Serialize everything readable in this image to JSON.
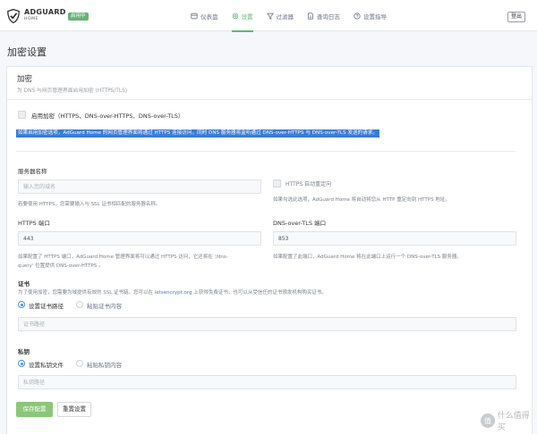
{
  "header": {
    "logo_name": "ADGUARD",
    "logo_sub": "HOME",
    "status_badge": "启用中",
    "nav": [
      {
        "label": "仪表盘",
        "icon": "dashboard-icon"
      },
      {
        "label": "设置",
        "icon": "settings-gear-icon",
        "active": true
      },
      {
        "label": "过滤器",
        "icon": "filter-funnel-icon"
      },
      {
        "label": "查询日志",
        "icon": "document-icon"
      },
      {
        "label": "设置指导",
        "icon": "help-circle-icon"
      }
    ],
    "logout_label": "登出",
    "accent_color": "#66b574"
  },
  "page": {
    "title": "加密设置"
  },
  "encryption": {
    "title": "加密",
    "subtitle": "为 DNS 与网页管理界面启用加密 (HTTPS/TLS)",
    "enable_label": "启用加密（HTTPS、DNS-over-HTTPS、DNS-over-TLS）",
    "enable_desc": "如果启用加密选项，AdGuard Home 的网页管理界面将通过 HTTPS 连接访问，同时 DNS 服务器将监听通过 DNS-over-HTTPS 与 DNS-over-TLS 发送的请求。",
    "server_name": {
      "label": "服务器名称",
      "placeholder": "输入您的域名",
      "hint": "若要使用 HTTPS，您需要输入与 SSL 证书相匹配的服务器名称。"
    },
    "https_redirect": {
      "label": "HTTPS 自动重定向",
      "hint": "如果勾选此选项，AdGuard Home 将自动将您从 HTTP 重定向到 HTTPS 地址。"
    },
    "https_port": {
      "label": "HTTPS 端口",
      "value": "443",
      "hint_line1": "如果配置了 HTTPS 端口，AdGuard Home 管理界面将可以通过 HTTPS 访问，它还将在 '/dns-",
      "hint_line2": "query' 位置提供 DNS-over-HTTPS 。"
    },
    "dot_port": {
      "label": "DNS-over-TLS 端口",
      "value": "853",
      "hint": "如果配置了此端口，AdGuard Home 将在此端口上运行一个 DNS-over-TLS 服务器。"
    },
    "certificate": {
      "label": "证书",
      "hint_pre": "为了使用加密，您需要为域提供有效的 SSL 证书链。您可以在",
      "hint_link": "letsencrypt.org",
      "hint_post": "上获得免费证书，也可以从受信任的证书颁发机构购买证书。",
      "option_path": "设置证书路径",
      "option_paste": "粘贴证书内容",
      "path_placeholder": "证书路径"
    },
    "private_key": {
      "label": "私钥",
      "option_path": "设置私钥文件",
      "option_paste": "粘贴私钥内容",
      "path_placeholder": "私钥路径"
    },
    "save_label": "保存配置",
    "reset_label": "重置设置"
  },
  "watermark": {
    "badge": "值",
    "text": "什么值得买"
  }
}
